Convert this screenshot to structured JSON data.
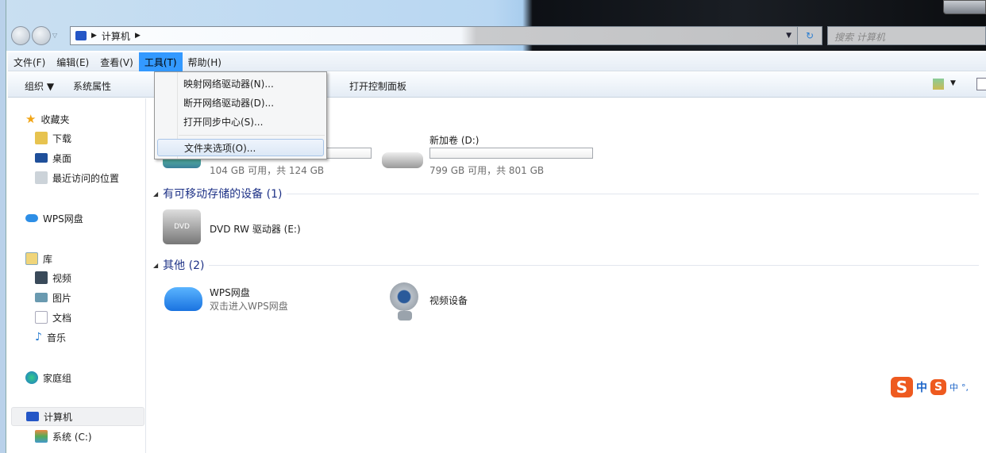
{
  "window": {
    "address_path": [
      "计算机"
    ],
    "search_placeholder": "搜索 计算机"
  },
  "menubar": [
    {
      "label": "文件(F)"
    },
    {
      "label": "编辑(E)"
    },
    {
      "label": "查看(V)"
    },
    {
      "label": "工具(T)",
      "active": true
    },
    {
      "label": "帮助(H)"
    }
  ],
  "toolbar": {
    "organize": "组织 ▼",
    "system_properties": "系统属性",
    "control_panel": "打开控制面板"
  },
  "tools_menu": [
    {
      "label": "映射网络驱动器(N)..."
    },
    {
      "label": "断开网络驱动器(D)..."
    },
    {
      "label": "打开同步中心(S)..."
    },
    {
      "label": "文件夹选项(O)...",
      "highlighted": true
    }
  ],
  "sidebar": {
    "favorites": {
      "label": "收藏夹",
      "items": [
        "下载",
        "桌面",
        "最近访问的位置"
      ]
    },
    "wps": "WPS网盘",
    "libraries": {
      "label": "库",
      "items": [
        "视频",
        "图片",
        "文档",
        "音乐"
      ]
    },
    "homegroup": "家庭组",
    "computer": {
      "label": "计算机",
      "items": [
        "系统 (C:)"
      ]
    }
  },
  "content": {
    "drives": [
      {
        "name": "",
        "free": "104 GB 可用，共 124 GB",
        "used_fraction": 0.16
      },
      {
        "name": "新加卷 (D:)",
        "free": "799 GB 可用，共 801 GB",
        "used_fraction": 0.0
      }
    ],
    "removable": {
      "header": "有可移动存储的设备 (1)",
      "items": [
        {
          "name": "DVD RW 驱动器 (E:)"
        }
      ]
    },
    "other": {
      "header": "其他 (2)",
      "items": [
        {
          "name": "WPS网盘",
          "sub": "双击进入WPS网盘"
        },
        {
          "name": "视频设备"
        }
      ]
    }
  },
  "ime": {
    "mode": "中"
  },
  "colors": {
    "menu_active": "#3399ff",
    "section_header": "#1e3287",
    "sogou": "#ee5a1f"
  }
}
